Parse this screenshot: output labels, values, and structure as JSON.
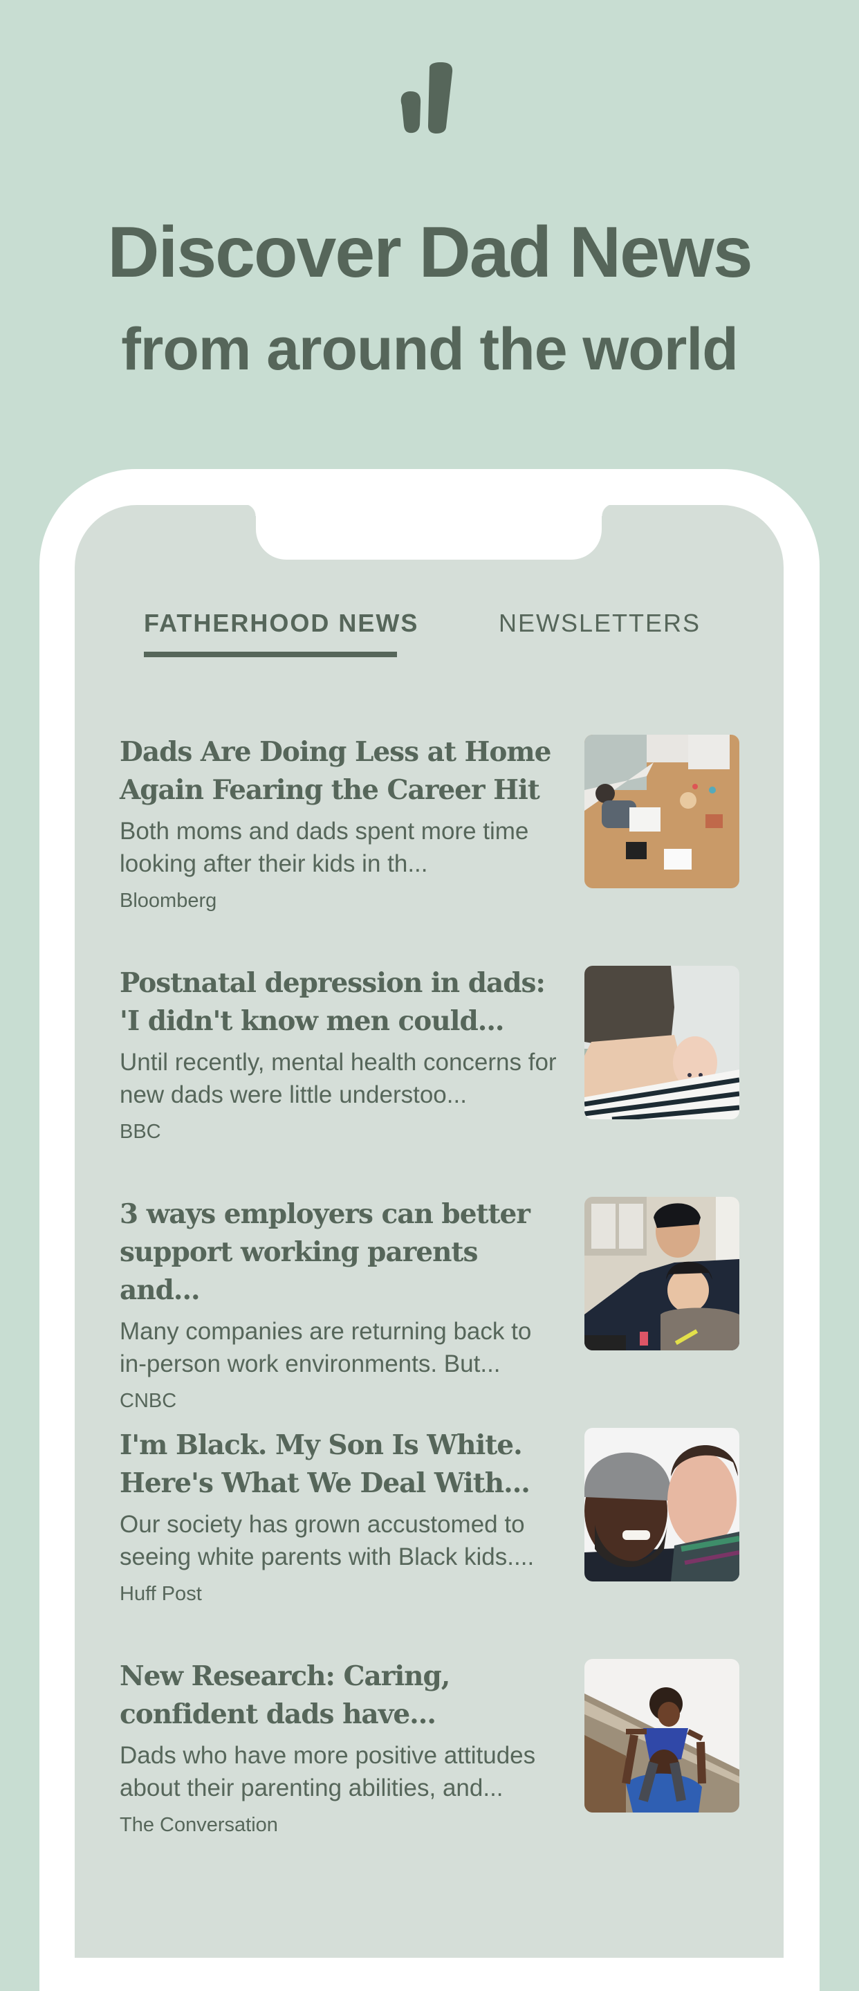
{
  "app": {
    "logo_icon": "bar-marks-logo-icon",
    "headline_line1": "Discover Dad News",
    "headline_line2": "from around the world"
  },
  "colors": {
    "background": "#c8ddd2",
    "screen": "#d5ded8",
    "text": "#56665a",
    "frame": "#ffffff"
  },
  "tabs": [
    {
      "label": "FATHERHOOD NEWS",
      "active": true
    },
    {
      "label": "NEWSLETTERS",
      "active": false
    }
  ],
  "articles": [
    {
      "title": "Dads Are Doing Less at Home Again Fearing the Career Hit",
      "description": "Both moms and dads spent more time looking after their kids in th...",
      "source": "Bloomberg",
      "image": "father-working-on-floor-with-child-photo"
    },
    {
      "title": "Postnatal depression in dads: 'I didn't know men could...",
      "description": "Until recently, mental health concerns for new dads were little understoo...",
      "source": "BBC",
      "image": "father-holding-newborn-photo"
    },
    {
      "title": "3 ways employers can better support working parents and...",
      "description": "Many companies are returning back to in-person work environments. But...",
      "source": "CNBC",
      "image": "father-with-toddler-at-laptop-photo"
    },
    {
      "title": "I'm Black. My Son Is White. Here's What We Deal With...",
      "description": "Our society has grown accustomed to seeing white parents with Black kids....",
      "source": "Huff Post",
      "image": "father-and-son-selfie-photo"
    },
    {
      "title": "New Research: Caring, confident dads have...",
      "description": "Dads who have more positive attitudes about their parenting abilities, and...",
      "source": "The Conversation",
      "image": "child-on-fathers-shoulders-photo"
    }
  ]
}
